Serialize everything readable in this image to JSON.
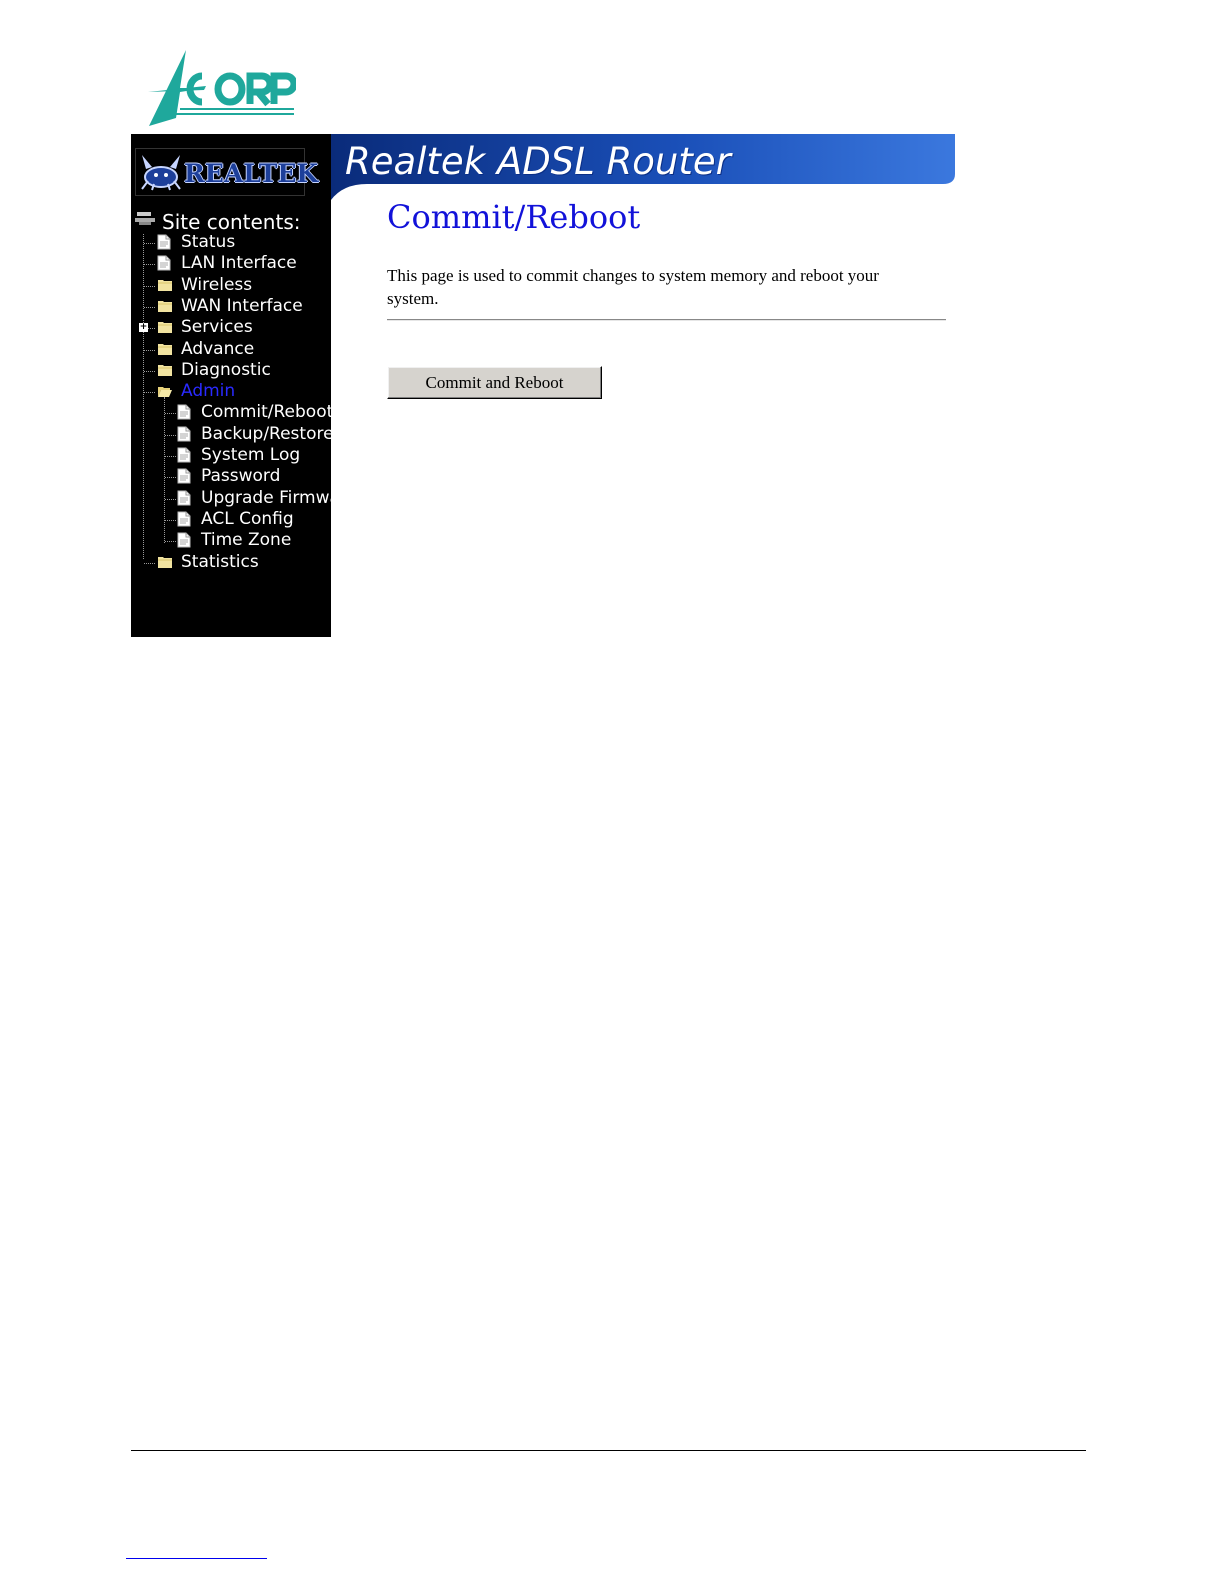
{
  "banner": {
    "title": "Realtek ADSL Router"
  },
  "realtek_logo": {
    "text": "REALTEK"
  },
  "nav": {
    "heading": "Site contents:",
    "items": [
      {
        "label": "Status",
        "icon": "page-icon"
      },
      {
        "label": "LAN Interface",
        "icon": "page-icon"
      },
      {
        "label": "Wireless",
        "icon": "folder-icon"
      },
      {
        "label": "WAN Interface",
        "icon": "folder-icon"
      },
      {
        "label": "Services",
        "icon": "folder-icon"
      },
      {
        "label": "Advance",
        "icon": "folder-icon"
      },
      {
        "label": "Diagnostic",
        "icon": "folder-icon"
      },
      {
        "label": "Admin",
        "icon": "open-folder-icon"
      },
      {
        "label": "Statistics",
        "icon": "folder-icon"
      }
    ],
    "admin_children": [
      {
        "label": "Commit/Reboot"
      },
      {
        "label": "Backup/Restore"
      },
      {
        "label": "System Log"
      },
      {
        "label": "Password"
      },
      {
        "label": "Upgrade Firmware"
      },
      {
        "label": "ACL Config"
      },
      {
        "label": "Time Zone"
      }
    ]
  },
  "main": {
    "title": "Commit/Reboot",
    "description": "This page is used to commit changes to system memory and reboot your system.",
    "button_label": "Commit and Reboot"
  },
  "colors": {
    "acorp_teal": "#1fa89c",
    "banner_blue": "#1a4fb8",
    "title_blue": "#1212d9",
    "active_nav": "#2a2aff"
  }
}
